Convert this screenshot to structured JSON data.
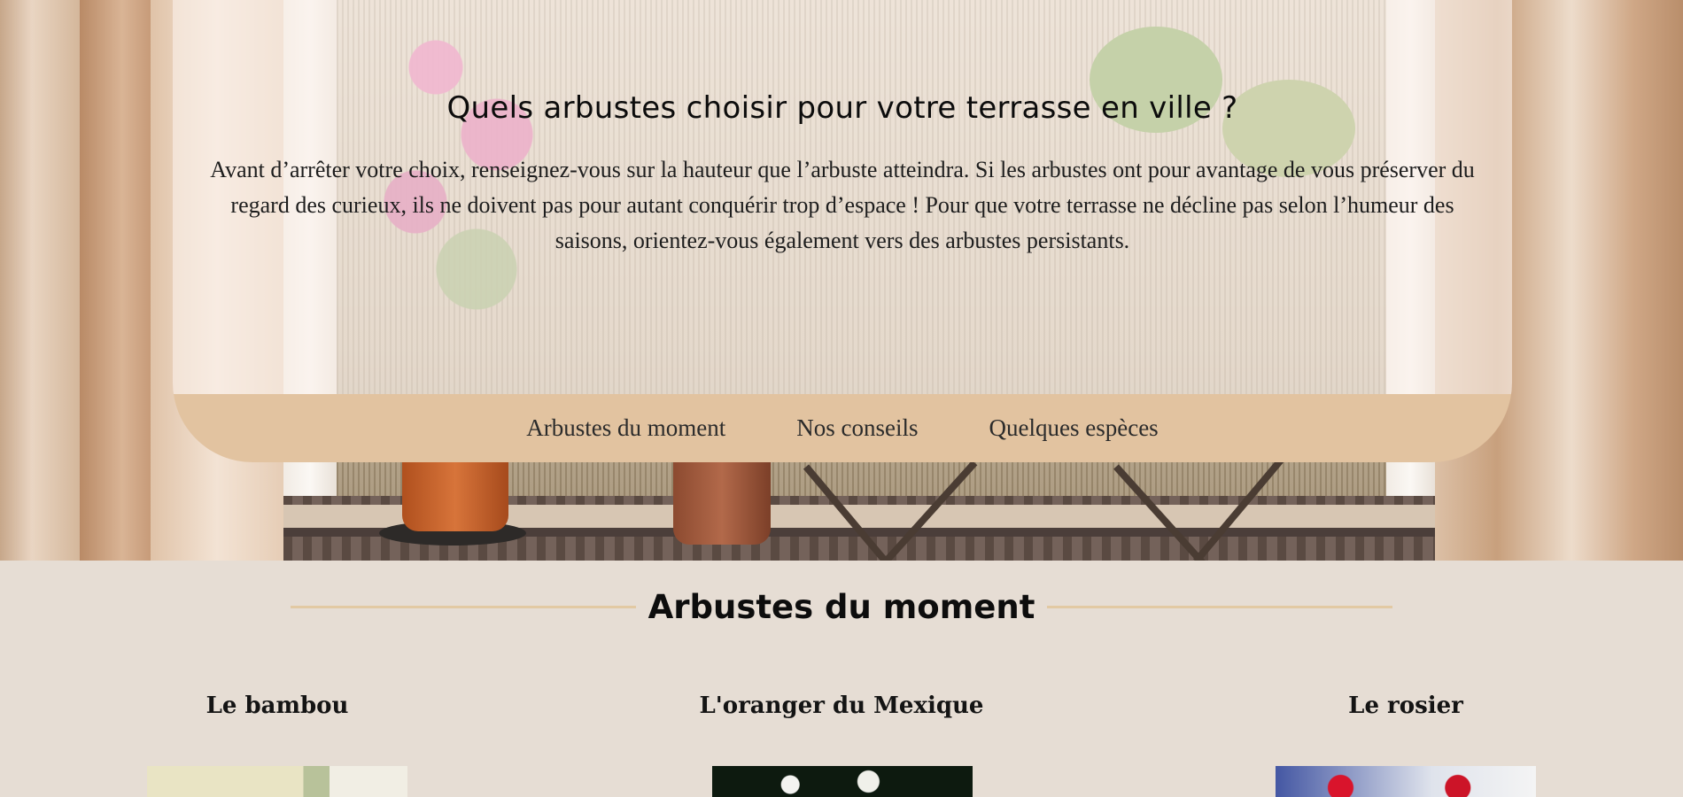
{
  "hero": {
    "title": "Quels arbustes choisir pour votre terrasse en ville ?",
    "text": "Avant d’arrêter votre choix, renseignez-vous sur la hauteur que l’arbuste atteindra. Si les arbustes ont pour avantage de vous préserver du regard des curieux, ils ne doivent pas pour autant conquérir trop d’espace ! Pour que votre terrasse ne décline pas selon l’humeur des saisons, orientez-vous également vers des arbustes persistants."
  },
  "nav": {
    "items": [
      {
        "label": "Arbustes du moment"
      },
      {
        "label": "Nos conseils"
      },
      {
        "label": "Quelques espèces"
      }
    ]
  },
  "section": {
    "title": "Arbustes du moment",
    "items": [
      {
        "title": "Le bambou"
      },
      {
        "title": "L'oranger du Mexique"
      },
      {
        "title": "Le rosier"
      }
    ]
  },
  "colors": {
    "page_background": "#e6ddd4",
    "nav_background": "#e2c3a0",
    "rule": "#e2c9a3"
  }
}
